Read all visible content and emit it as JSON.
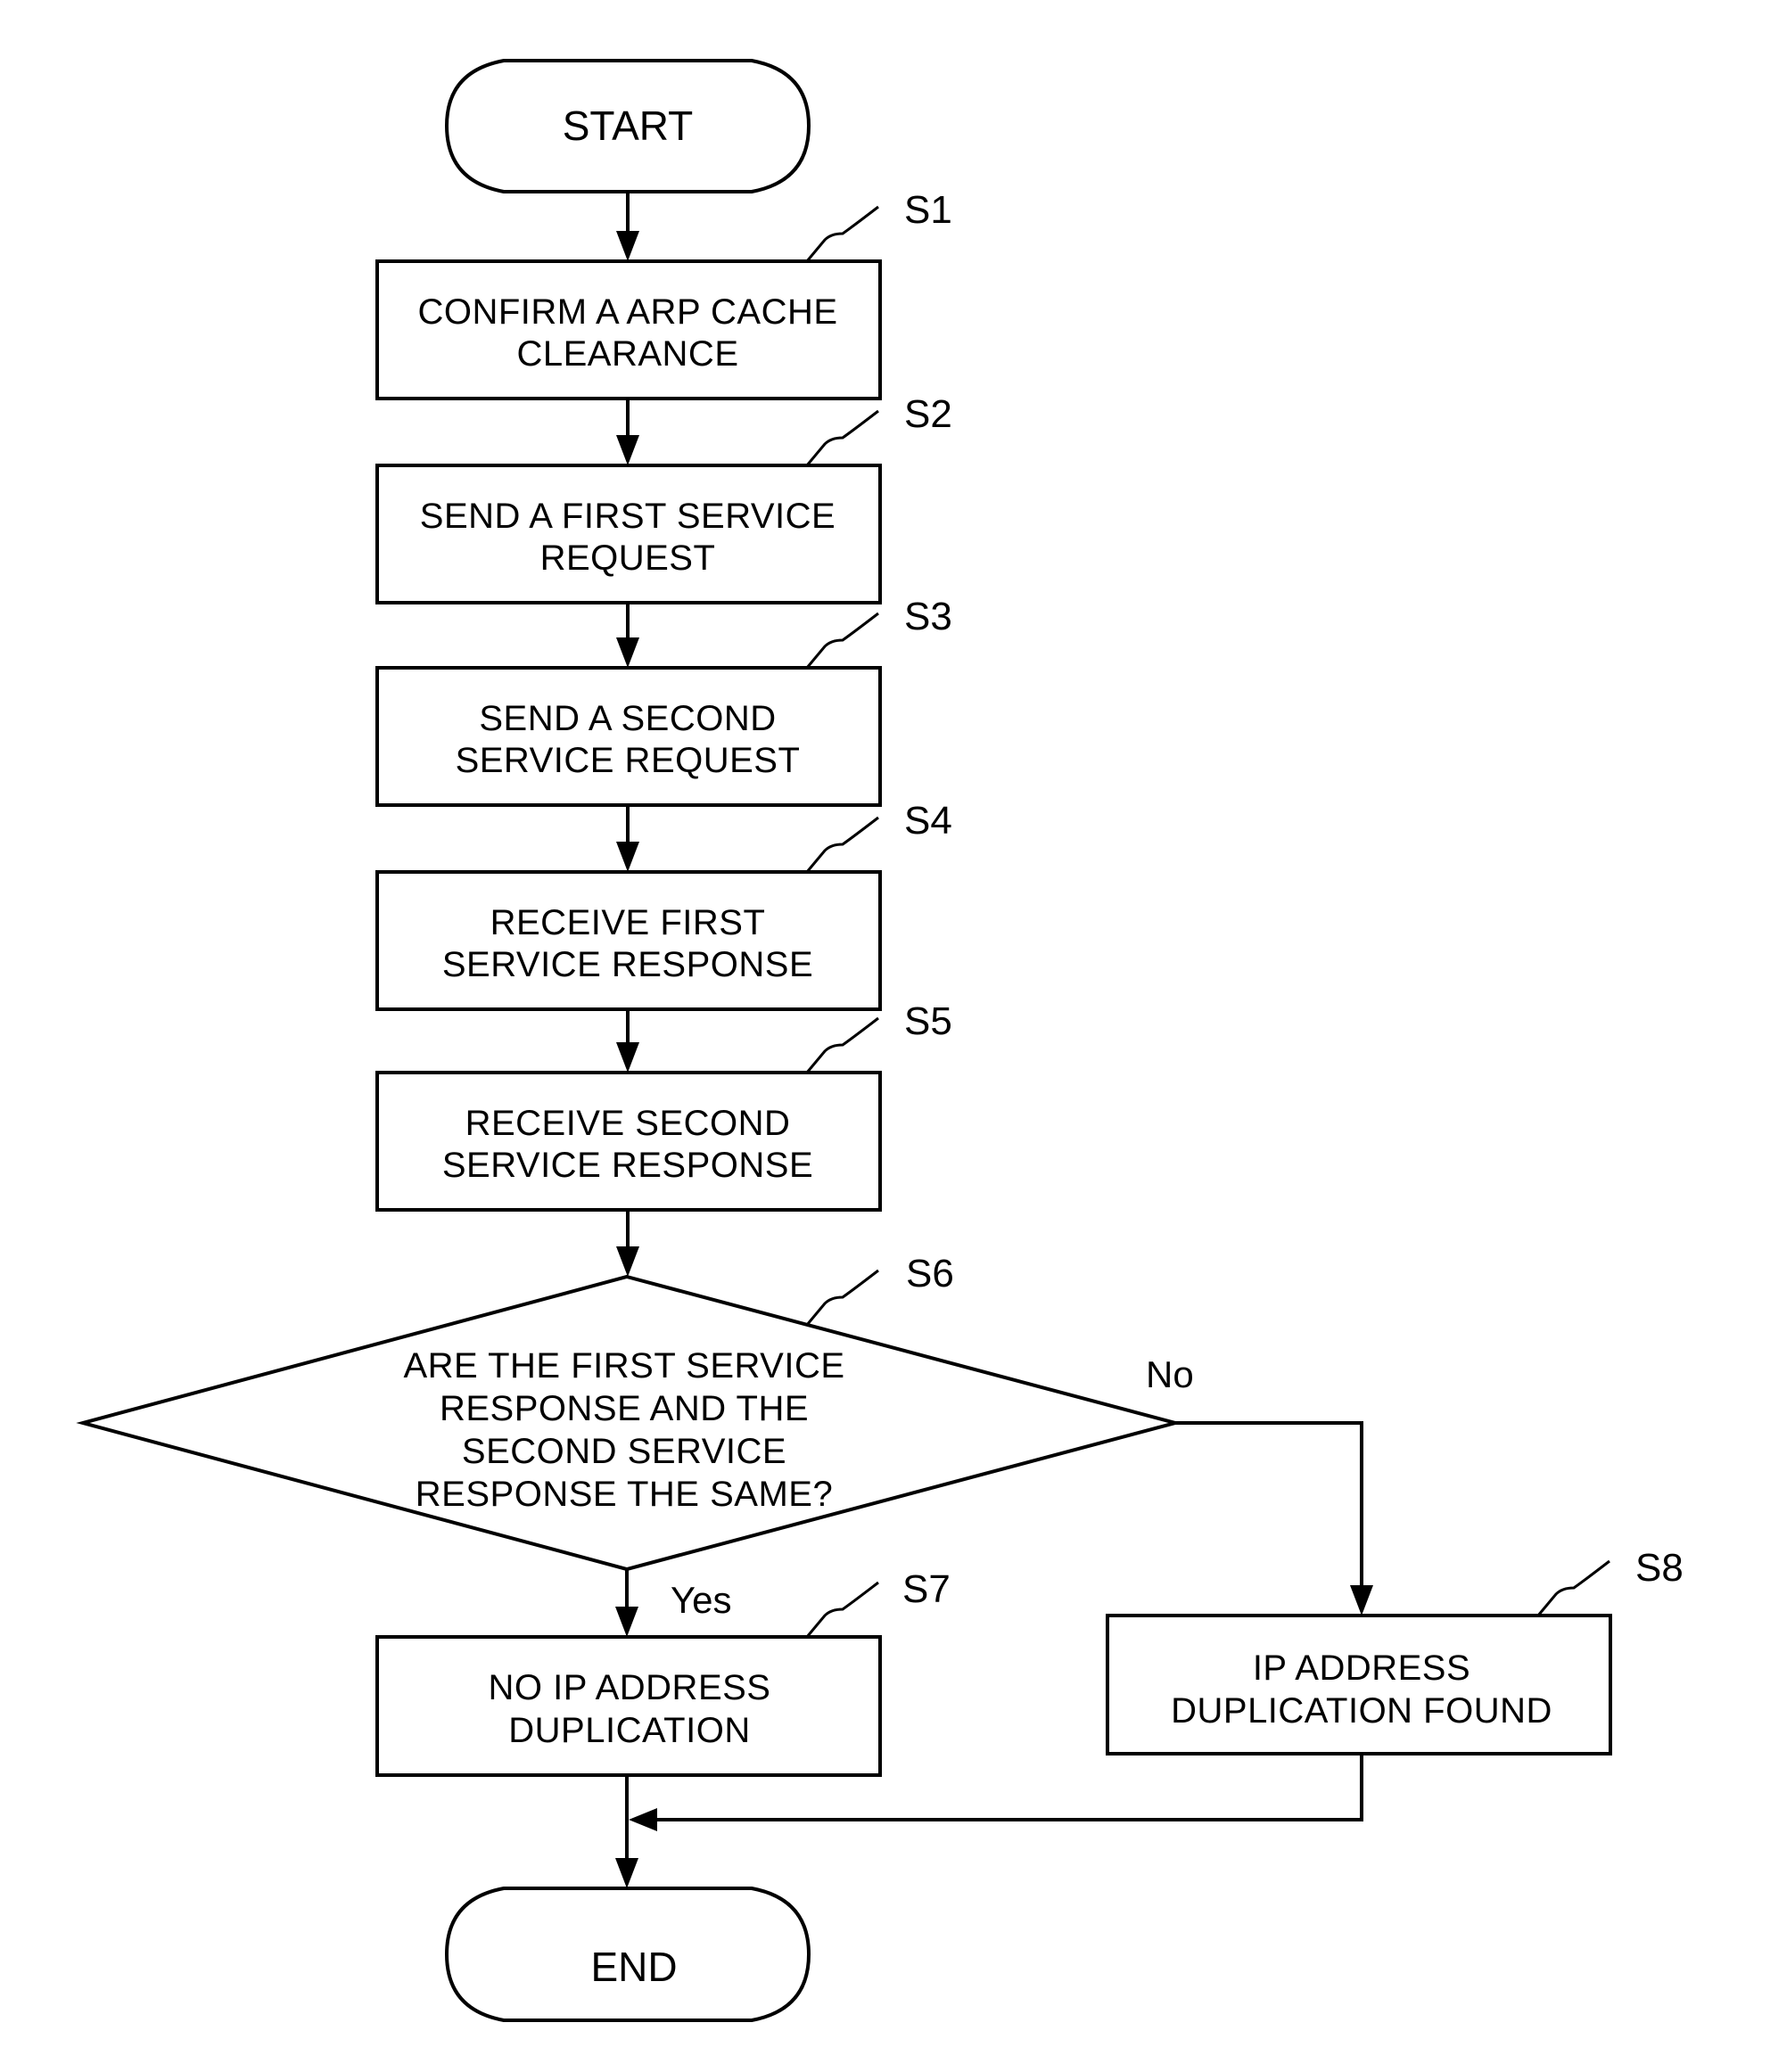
{
  "diagram": {
    "type": "flowchart",
    "start": {
      "label": "START"
    },
    "end": {
      "label": "END"
    },
    "steps": [
      {
        "id": "S1",
        "lines": [
          "CONFIRM A ARP CACHE",
          "CLEARANCE"
        ]
      },
      {
        "id": "S2",
        "lines": [
          "SEND A FIRST SERVICE",
          "REQUEST"
        ]
      },
      {
        "id": "S3",
        "lines": [
          "SEND A SECOND",
          "SERVICE REQUEST"
        ]
      },
      {
        "id": "S4",
        "lines": [
          "RECEIVE FIRST",
          "SERVICE RESPONSE"
        ]
      },
      {
        "id": "S5",
        "lines": [
          "RECEIVE SECOND",
          "SERVICE RESPONSE"
        ]
      }
    ],
    "decision": {
      "id": "S6",
      "lines": [
        "ARE THE FIRST SERVICE",
        "RESPONSE AND THE",
        "SECOND SERVICE",
        "RESPONSE THE SAME?"
      ],
      "yes_label": "Yes",
      "no_label": "No"
    },
    "yes_step": {
      "id": "S7",
      "lines": [
        "NO IP ADDRESS",
        "DUPLICATION"
      ]
    },
    "no_step": {
      "id": "S8",
      "lines": [
        "IP ADDRESS",
        "DUPLICATION FOUND"
      ]
    },
    "edges": [
      {
        "from": "START",
        "to": "S1"
      },
      {
        "from": "S1",
        "to": "S2"
      },
      {
        "from": "S2",
        "to": "S3"
      },
      {
        "from": "S3",
        "to": "S4"
      },
      {
        "from": "S4",
        "to": "S5"
      },
      {
        "from": "S5",
        "to": "S6"
      },
      {
        "from": "S6",
        "to": "S7",
        "label": "Yes"
      },
      {
        "from": "S6",
        "to": "S8",
        "label": "No"
      },
      {
        "from": "S7",
        "to": "END"
      },
      {
        "from": "S8",
        "to": "END"
      }
    ]
  }
}
